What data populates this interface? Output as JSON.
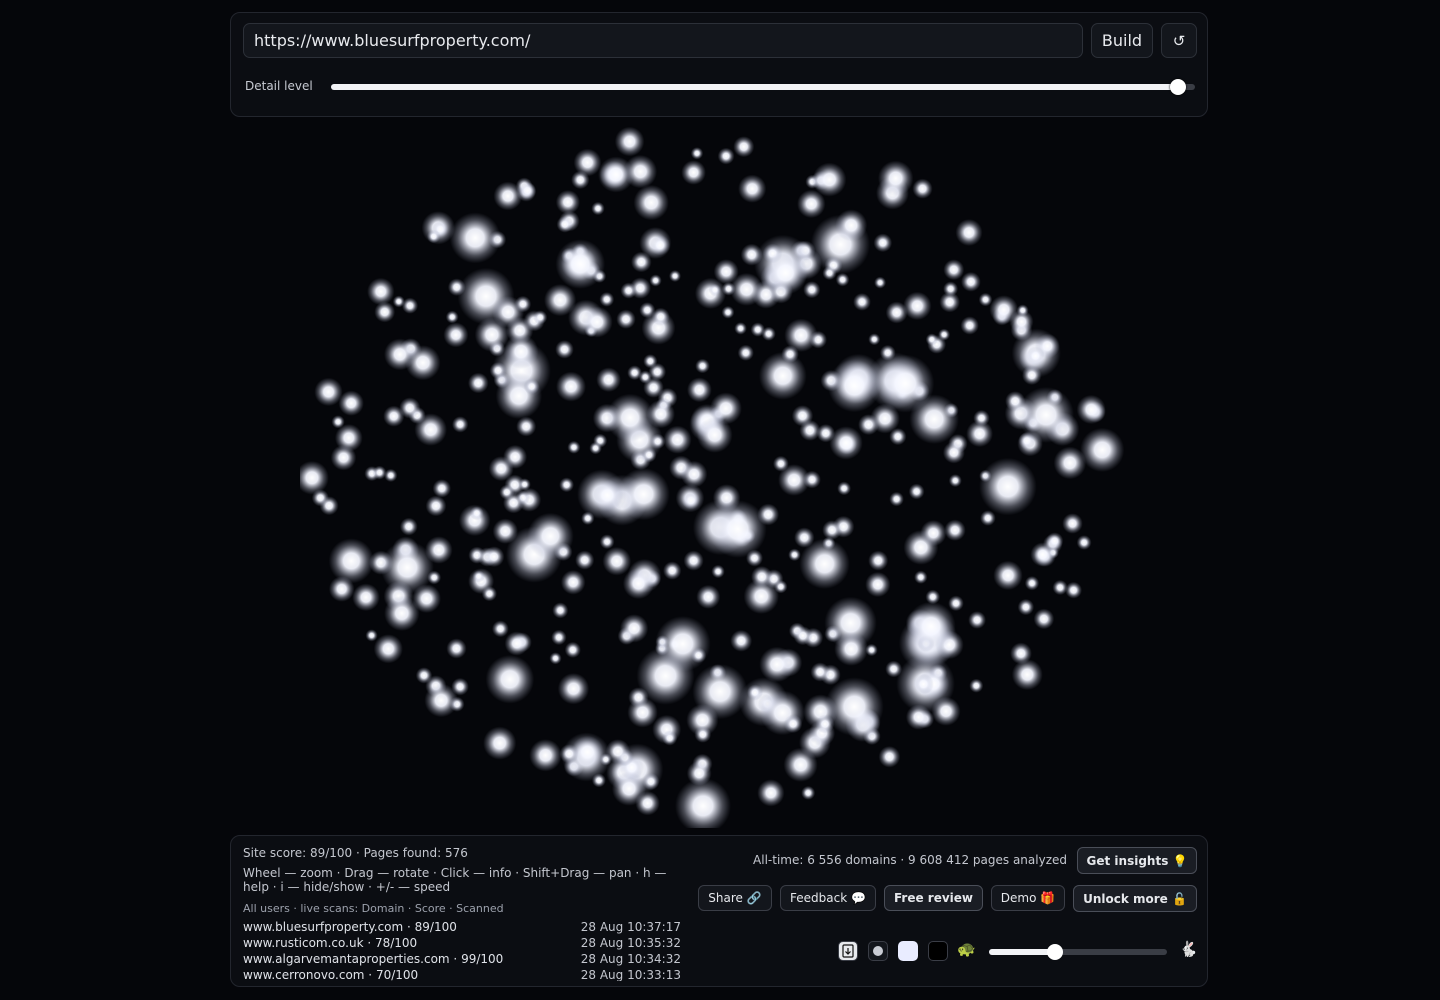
{
  "toolbar": {
    "url_value": "https://www.bluesurfproperty.com/",
    "build_label": "Build",
    "reset_glyph": "↺",
    "detail_label": "Detail level",
    "detail_value_pct": 98
  },
  "info": {
    "site_line": "Site score: 89/100 · Pages found: 576",
    "help_text": "Wheel — zoom · Drag — rotate · Click — info · Shift+Drag — pan · h — help · i — hide/show · +/- — speed",
    "scans_header": "All users · live scans: Domain · Score · Scanned",
    "scans": [
      {
        "domain": "www.bluesurfproperty.com · 89/100",
        "time": "28 Aug 10:37:17"
      },
      {
        "domain": "www.rusticom.co.uk · 78/100",
        "time": "28 Aug 10:35:32"
      },
      {
        "domain": "www.algarvemantaproperties.com · 99/100",
        "time": "28 Aug 10:34:32"
      },
      {
        "domain": "www.cerronovo.com · 70/100",
        "time": "28 Aug 10:33:13"
      }
    ]
  },
  "stats": {
    "alltime": "All-time: 6 556 domains · 9 608 412 pages analyzed"
  },
  "actions": {
    "get_insights": "Get insights 💡",
    "share": "Share 🔗",
    "feedback": "Feedback 💬",
    "free_review": "Free review",
    "demo": "Demo 🎁",
    "unlock_more": "Unlock more 🔓"
  },
  "controls": {
    "icons": [
      "download-icon",
      "dot-size-small-icon",
      "theme-light-icon",
      "theme-dark-icon",
      "turtle-icon",
      "rabbit-icon"
    ],
    "turtle_glyph": "🐢",
    "rabbit_glyph": "🐇",
    "speed_value_pct": 37
  },
  "colors": {
    "background": "#05060a",
    "panel": "#0b0d12",
    "node_glow": "#ffffff"
  }
}
